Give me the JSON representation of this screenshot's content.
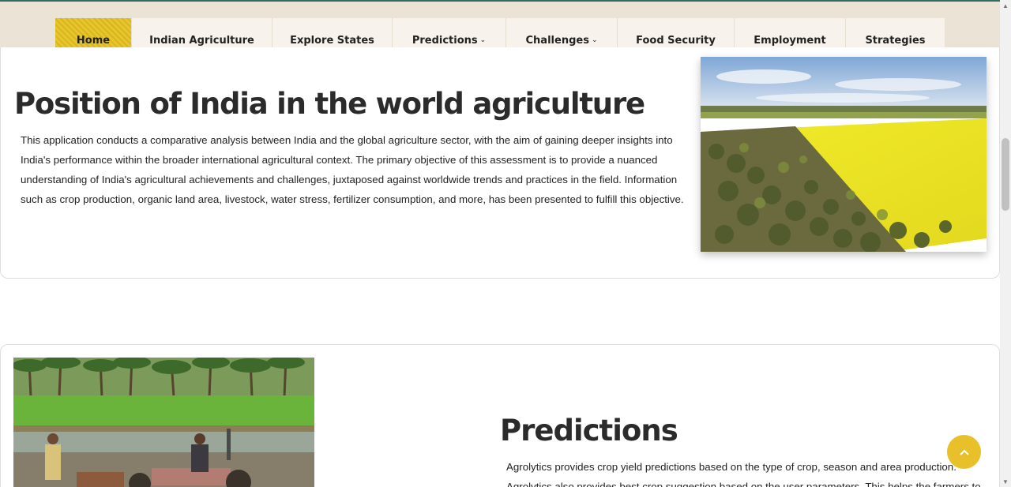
{
  "nav": {
    "items": [
      {
        "label": "Home",
        "active": true,
        "dropdown": false
      },
      {
        "label": "Indian Agriculture",
        "active": false,
        "dropdown": false
      },
      {
        "label": "Explore States",
        "active": false,
        "dropdown": false
      },
      {
        "label": "Predictions",
        "active": false,
        "dropdown": true
      },
      {
        "label": "Challenges",
        "active": false,
        "dropdown": true
      },
      {
        "label": "Food Security",
        "active": false,
        "dropdown": false
      },
      {
        "label": "Employment",
        "active": false,
        "dropdown": false
      },
      {
        "label": "Strategies",
        "active": false,
        "dropdown": false
      }
    ],
    "dropdown_icon": "chevron-down-icon"
  },
  "section_world": {
    "title": "Position of India in the world agriculture",
    "body": "This application conducts a comparative analysis between India and the global agriculture sector, with the aim of gaining deeper insights into India's performance within the broader international agricultural context. The primary objective of this assessment is to provide a nuanced understanding of India's agricultural achievements and challenges, juxtaposed against worldwide trends and practices in the field. Information such as crop production, organic land area, livestock, water stress, fertilizer consumption, and more, has been presented to fulfill this objective."
  },
  "section_predictions": {
    "title": "Predictions",
    "body": "Agrolytics provides crop yield predictions based on the type of crop, season and area production. Agrolytics also provides best crop suggestion based on the user parameters. This helps the farmers to"
  },
  "colors": {
    "accent": "#e7c52c",
    "header_bg": "#ebe3d6",
    "nav_bg": "#f7f3ec",
    "top_line": "#2f6f63"
  },
  "icons": {
    "scroll_top": "chevron-up-icon"
  }
}
